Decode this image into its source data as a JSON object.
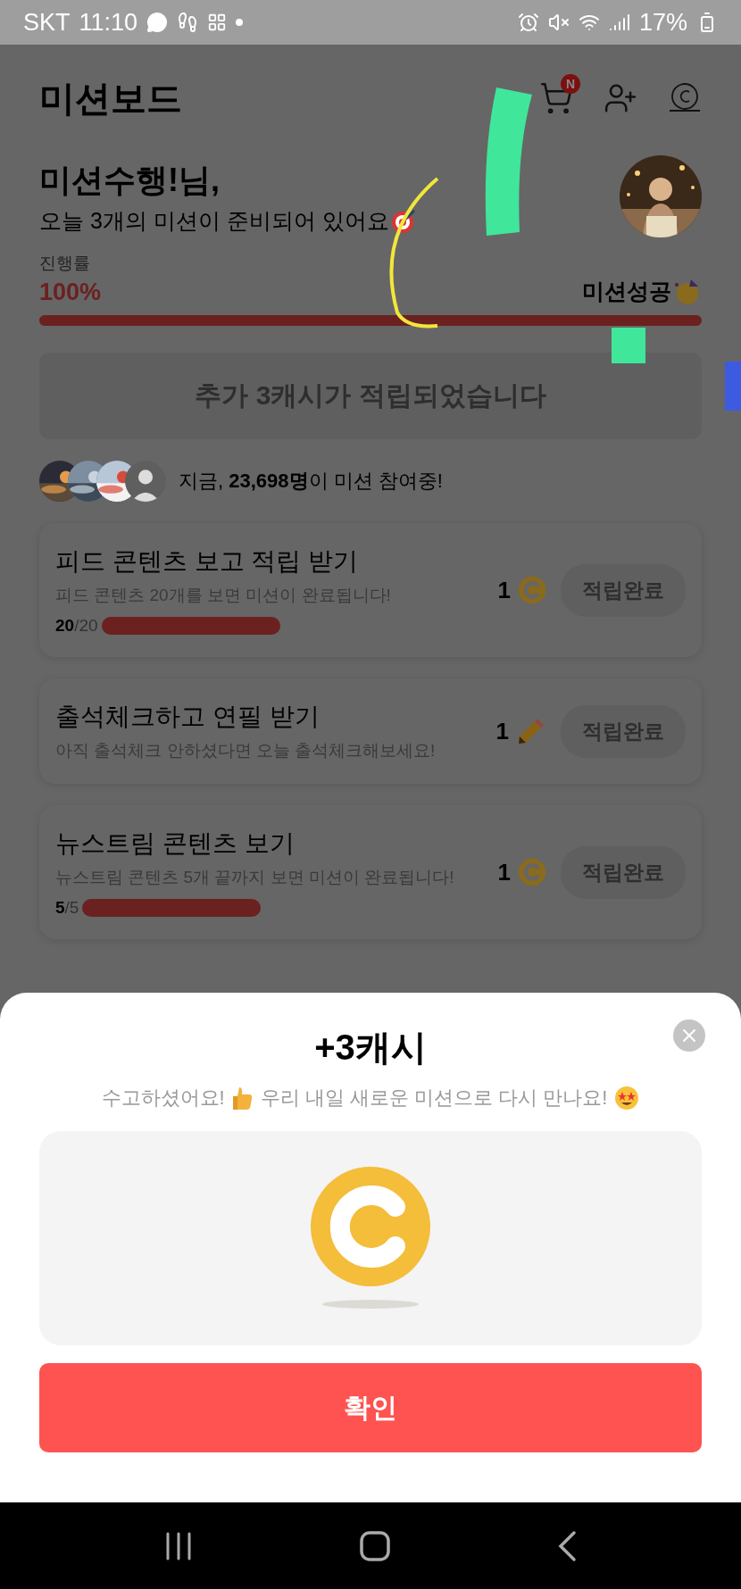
{
  "status_bar": {
    "carrier": "SKT",
    "time": "11:10",
    "battery": "17%"
  },
  "header": {
    "title": "미션보드",
    "cart_badge": "N"
  },
  "greeting": {
    "name": "미션수행!님,",
    "message": "오늘 3개의 미션이 준비되어 있어요"
  },
  "progress": {
    "label": "진행률",
    "value": "100%",
    "status": "미션성공",
    "level": 1
  },
  "banner": "추가 3캐시가 적립되었습니다",
  "participants": {
    "text": "지금, **23,698명**이 미션 참여중!",
    "avatars": [
      {
        "kind": "picture"
      },
      {
        "kind": "picture"
      },
      {
        "kind": "picture"
      },
      {
        "kind": "placeholder"
      }
    ]
  },
  "missions": [
    {
      "title": "피드 콘텐츠 보고 적립 받기",
      "description": "피드 콘텐츠 20개를 보면 미션이 완료됩니다!",
      "reward": "1",
      "kind": "coin",
      "progress_text": "**20**/20",
      "level": 1,
      "button": "적립완료"
    },
    {
      "title": "출석체크하고 연필 받기",
      "description": "아직 출석체크 안하셨다면 오늘 출석체크해보세요!",
      "reward": "1",
      "kind": "pencil",
      "button": "적립완료"
    },
    {
      "title": "뉴스트림 콘텐츠 보기",
      "description": "뉴스트림 콘텐츠 5개 끝까지 보면 미션이 완료됩니다!",
      "reward": "1",
      "kind": "coin",
      "progress_text": "**5**/5",
      "level": 1,
      "button": "적립완료"
    }
  ],
  "dialog": {
    "title": "+3캐시",
    "message_parts": [
      "수고하셨어요!",
      "우리 내일 새로운 미션으로 다시 만나요!"
    ],
    "confirm": "확인"
  }
}
